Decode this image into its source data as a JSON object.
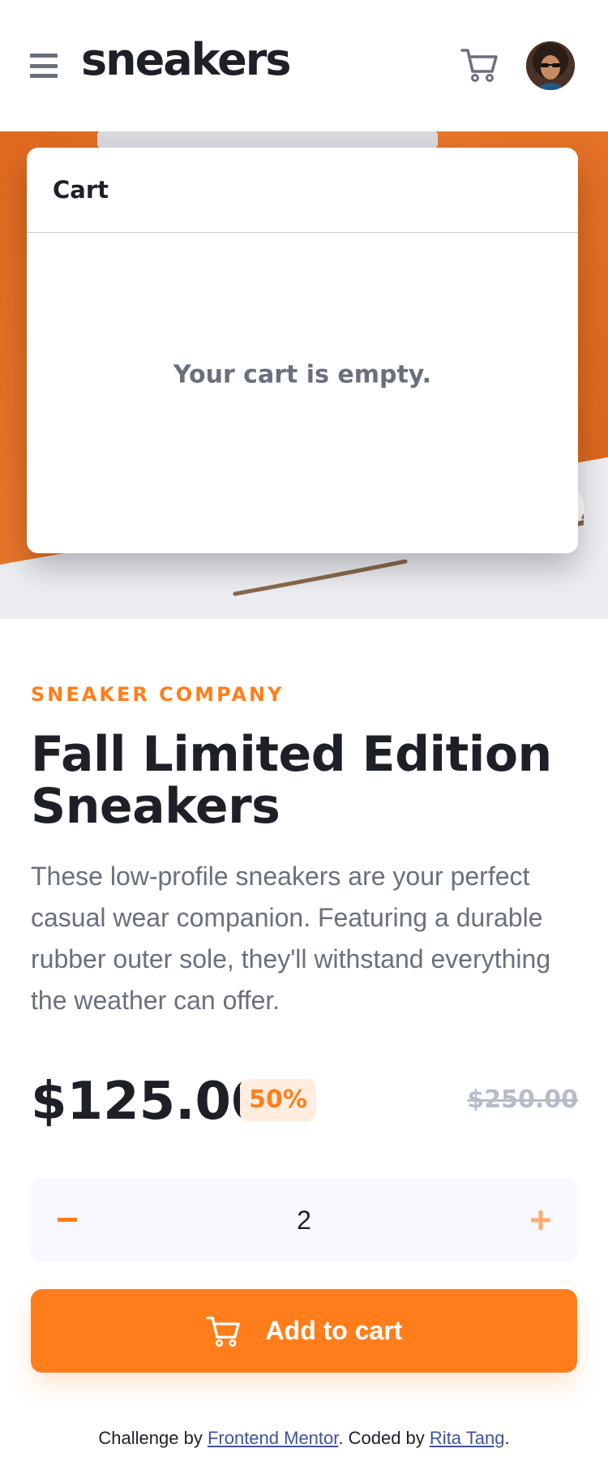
{
  "header": {
    "brand": "sneakers",
    "menu_icon": "hamburger-menu-icon",
    "cart_icon": "cart-icon",
    "avatar_icon": "user-avatar"
  },
  "cart": {
    "title": "Cart",
    "empty_message": "Your cart is empty."
  },
  "product": {
    "company": "SNEAKER COMPANY",
    "title": "Fall Limited Edition Sneakers",
    "description": "These low-profile sneakers are your perfect casual wear companion. Featuring a durable rubber outer sole, they'll withstand everything the weather can offer.",
    "price": "$125.00",
    "discount": "50%",
    "original_price": "$250.00"
  },
  "quantity": {
    "value": "2",
    "minus_icon": "minus-icon",
    "plus_icon": "plus-icon"
  },
  "add_to_cart": {
    "label": "Add to cart",
    "icon": "cart-icon"
  },
  "footer": {
    "prefix": "Challenge by",
    "link1": "Frontend Mentor",
    "middle": ". Coded by",
    "link2": "Rita Tang",
    "suffix": "."
  },
  "colors": {
    "accent": "#ff7e1b",
    "accent_pale": "#ffede0",
    "text_dark": "#1d2026",
    "text_gray": "#69707d",
    "light_bg": "#f6f8fd"
  }
}
